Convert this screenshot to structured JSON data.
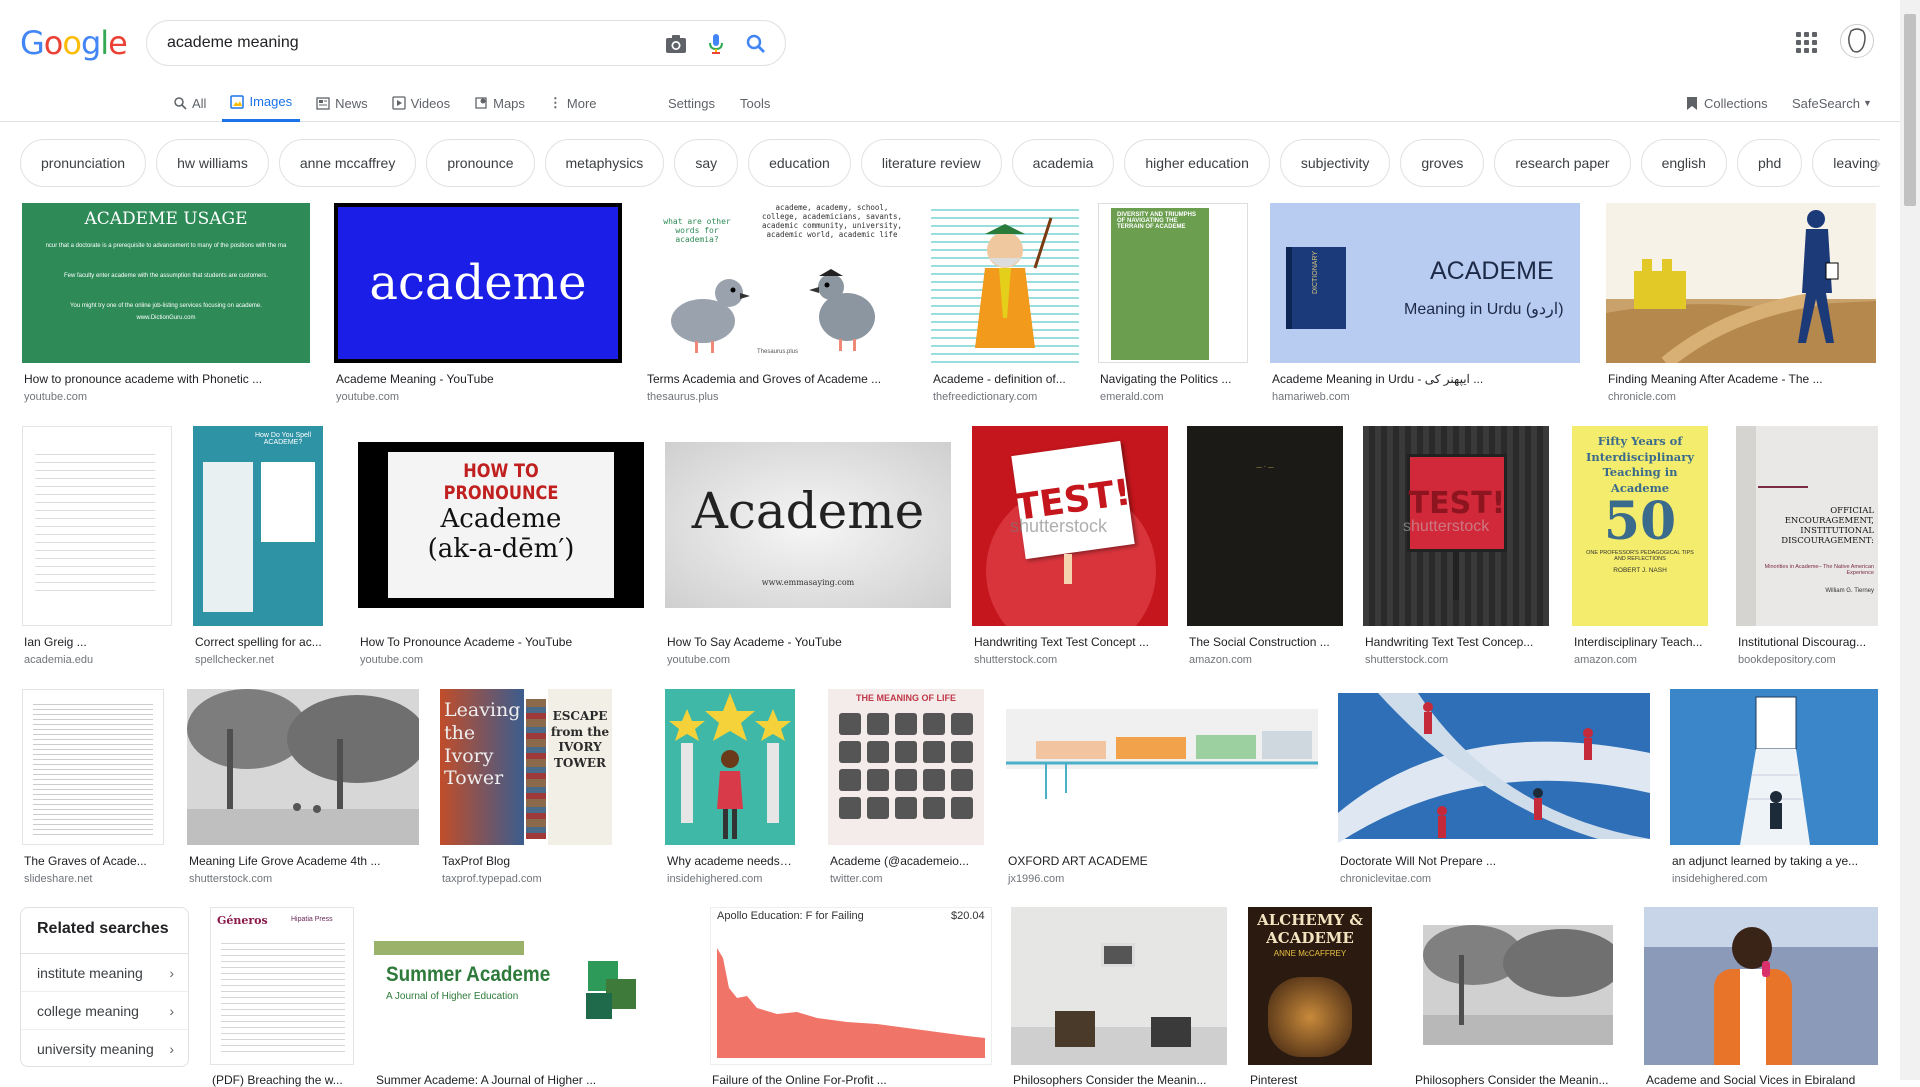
{
  "logo": {
    "text": "Google"
  },
  "search": {
    "query": "academe meaning"
  },
  "tabs": [
    {
      "label": "All",
      "icon": "search-icon"
    },
    {
      "label": "Images",
      "icon": "image-icon",
      "active": true
    },
    {
      "label": "News",
      "icon": "newspaper-icon"
    },
    {
      "label": "Videos",
      "icon": "play-icon"
    },
    {
      "label": "Maps",
      "icon": "map-pin-icon"
    },
    {
      "label": "More",
      "icon": "more-dots-icon"
    }
  ],
  "tools": {
    "settings": "Settings",
    "tools": "Tools",
    "collections": "Collections",
    "safesearch": "SafeSearch"
  },
  "chips": [
    "pronunciation",
    "hw williams",
    "anne mccaffrey",
    "pronounce",
    "metaphysics",
    "say",
    "education",
    "literature review",
    "academia",
    "higher education",
    "subjectivity",
    "groves",
    "research paper",
    "english",
    "phd",
    "leaving"
  ],
  "results": {
    "r1": [
      {
        "caption": "How to pronounce academe with Phonetic ...",
        "source": "youtube.com",
        "thumb": {
          "title": "ACADEME USAGE",
          "l1": "ncur that a doctorate is a prerequisite to advancement to many of the positions with the ma",
          "l2": "Few faculty enter academe with the assumption that students are customers.",
          "l3": "You might try one of the online job-listing services focusing on academe.",
          "l4": "www.DictionGuru.com"
        }
      },
      {
        "caption": "Academe Meaning - YouTube",
        "source": "youtube.com",
        "thumb": {
          "word": "academe"
        }
      },
      {
        "caption": "Terms Academia and Groves of Academe ...",
        "source": "thesaurus.plus",
        "thumb": {
          "q": "what are other words for academia?",
          "words": "academe, academy, school, college, academicians, savants, academic community, university, academic world, academic life",
          "brand": "Thesaurus.plus"
        }
      },
      {
        "caption": "Academe - definition of...",
        "source": "thefreedictionary.com"
      },
      {
        "caption": "Navigating the Politics ...",
        "source": "emerald.com",
        "thumb": {
          "title": "DIVERSITY AND TRIUMPHS OF NAVIGATING THE TERRAIN OF ACADEME"
        }
      },
      {
        "caption": "Academe Meaning in Urdu - ایپھنر کی ...",
        "source": "hamariweb.com",
        "thumb": {
          "word": "ACADEME",
          "sub": "Meaning in Urdu (اردو)",
          "book": "DICTIONARY"
        }
      },
      {
        "caption": "Finding Meaning After Academe - The ...",
        "source": "chronicle.com"
      }
    ],
    "r2": [
      {
        "caption": "Ian Greig ...",
        "source": "academia.edu"
      },
      {
        "caption": "Correct spelling for ac...",
        "source": "spellchecker.net",
        "thumb": {
          "title": "How Do You Spell ACADEME?"
        }
      },
      {
        "caption": "How To Pronounce Academe - YouTube",
        "source": "youtube.com",
        "thumb": {
          "l1": "HOW TO PRONOUNCE",
          "l2": "Academe",
          "l3": "(ak-a-dēm′)"
        }
      },
      {
        "caption": "How To Say Academe - YouTube",
        "source": "youtube.com",
        "thumb": {
          "word": "Academe",
          "url": "www.emmasaying.com"
        }
      },
      {
        "caption": "Handwriting Text Test Concept ...",
        "source": "shutterstock.com",
        "thumb": {
          "word": "TEST!",
          "wm": "shutterstock"
        }
      },
      {
        "caption": "The Social Construction ...",
        "source": "amazon.com"
      },
      {
        "caption": "Handwriting Text Test Concep...",
        "source": "shutterstock.com",
        "thumb": {
          "word": "TEST!",
          "wm": "shutterstock"
        }
      },
      {
        "caption": "Interdisciplinary Teach...",
        "source": "amazon.com",
        "thumb": {
          "l1": "Fifty Years of Interdisciplinary Teaching in Academe",
          "num": "50",
          "l2": "ONE PROFESSOR'S PEDAGOGICAL TIPS AND REFLECTIONS",
          "author": "ROBERT J. NASH"
        }
      },
      {
        "caption": "Institutional Discourag...",
        "source": "bookdepository.com",
        "thumb": {
          "title": "OFFICIAL ENCOURAGEMENT, INSTITUTIONAL DISCOURAGEMENT:",
          "sub": "Minorities in Academe– The Native American Experience",
          "author": "William G. Tierney"
        }
      }
    ],
    "r3": [
      {
        "caption": "The Graves of Acade...",
        "source": "slideshare.net"
      },
      {
        "caption": "Meaning Life Grove Academe 4th ...",
        "source": "shutterstock.com"
      },
      {
        "caption": "TaxProf Blog",
        "source": "taxprof.typepad.com",
        "thumb": {
          "left": "Leaving the Ivory Tower",
          "right": "ESCAPE from the IVORY TOWER"
        }
      },
      {
        "caption": "Why academe needs t...",
        "source": "insidehighered.com"
      },
      {
        "caption": "Academe (@academeio...",
        "source": "twitter.com",
        "thumb": {
          "title": "THE MEANING OF LIFE"
        }
      },
      {
        "caption": "OXFORD ART ACADEME",
        "source": "jx1996.com"
      },
      {
        "caption": "Doctorate Will Not Prepare ...",
        "source": "chroniclevitae.com"
      },
      {
        "caption": "an adjunct learned by taking a ye...",
        "source": "insidehighered.com"
      }
    ],
    "r4": [
      {
        "caption": "(PDF) Breaching the w...",
        "source": "",
        "thumb": {
          "brand": "Géneros",
          "brand2": "Hipatia Press"
        }
      },
      {
        "caption": "Summer Academe: A Journal of Higher ...",
        "source": "",
        "thumb": {
          "title": "Summer Academe",
          "sub": "A Journal of Higher Education"
        }
      },
      {
        "caption": "Failure of the Online For-Profit ...",
        "source": "",
        "thumb": {
          "title": "Apollo Education: F for Failing",
          "price": "$20.04"
        }
      },
      {
        "caption": "Philosophers Consider the Meanin...",
        "source": ""
      },
      {
        "caption": "Pinterest",
        "source": "",
        "thumb": {
          "l1": "ALCHEMY &",
          "l2": "ACADEME",
          "l3": "ANNE McCAFFREY"
        }
      },
      {
        "caption": "Philosophers Consider the Meanin...",
        "source": ""
      },
      {
        "caption": "Academe and Social Vices in Ebiraland",
        "source": ""
      }
    ]
  },
  "related": {
    "title": "Related searches",
    "items": [
      "institute meaning",
      "college meaning",
      "university meaning"
    ]
  },
  "colors": {
    "blue": "#4285f4",
    "red": "#ea4335",
    "yellow": "#fbbc05",
    "green": "#34a853",
    "accent": "#1a73e8"
  }
}
